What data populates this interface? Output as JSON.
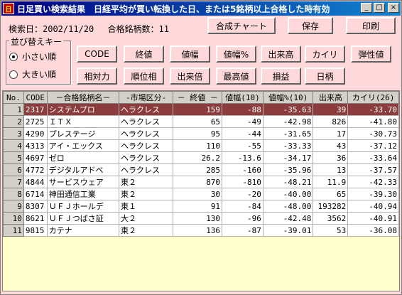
{
  "window": {
    "title": "日足買い検索結果　日経平均が買い転換した日、または5銘柄以上合格した時有効",
    "icon_text": "日",
    "controls": [
      "_",
      "□",
      "×"
    ]
  },
  "info": {
    "search_date": "検索日：2002/11/20",
    "count": "合格銘柄数：11"
  },
  "toolbar": {
    "composite_chart": "合成チャート",
    "save": "保存",
    "print": "印刷"
  },
  "sort": {
    "title": "並び替えキー",
    "ascending": "小さい順",
    "descending": "大きい順",
    "selected": "ascending"
  },
  "sort_buttons": [
    "CODE",
    "終値",
    "値幅",
    "値幅%",
    "出来高",
    "カイリ",
    "弾性値",
    "相対力",
    "順位相",
    "出来倍",
    "最高値",
    "損益",
    "日柄"
  ],
  "table": {
    "columns": [
      "No.",
      "CODE",
      "－合格銘柄名－",
      "-市場区分-",
      "－ 終値 －",
      "値幅(10)",
      "値幅%(10)",
      "出来高",
      "カイリ(26)"
    ],
    "selected_row": 0,
    "rows": [
      [
        "1",
        "2317",
        "システムプロ",
        "ヘラクレス",
        "159",
        "-88",
        "-35.63",
        "39",
        "-33.70"
      ],
      [
        "2",
        "2725",
        "ＩＴＸ",
        "ヘラクレス",
        "65",
        "-49",
        "-42.98",
        "826",
        "-41.80"
      ],
      [
        "3",
        "4290",
        "プレステージ",
        "ヘラクレス",
        "95",
        "-44",
        "-31.65",
        "17",
        "-30.73"
      ],
      [
        "4",
        "4313",
        "アイ・エックス",
        "ヘラクレス",
        "110",
        "-55",
        "-33.33",
        "43",
        "-37.12"
      ],
      [
        "5",
        "4697",
        "ゼロ",
        "ヘラクレス",
        "26.2",
        "-13.6",
        "-34.17",
        "36",
        "-33.64"
      ],
      [
        "6",
        "4772",
        "デジタルアドベ",
        "ヘラクレス",
        "285",
        "-160",
        "-35.96",
        "13",
        "-37.57"
      ],
      [
        "7",
        "4844",
        "サービスウェア",
        "東２",
        "870",
        "-810",
        "-48.21",
        "11.9",
        "-42.33"
      ],
      [
        "8",
        "6714",
        "神田通信工業",
        "東２",
        "30",
        "-20",
        "-40.00",
        "65",
        "-39.30"
      ],
      [
        "9",
        "8307",
        "ＵＦＪホールデ",
        "東１",
        "91",
        "-84",
        "-48.00",
        "193282",
        "-40.94"
      ],
      [
        "10",
        "8621",
        "ＵＦＪつばさ証",
        "大２",
        "130",
        "-96",
        "-42.48",
        "3562",
        "-40.91"
      ],
      [
        "11",
        "9815",
        "カテナ",
        "東２",
        "136",
        "-87",
        "-39.01",
        "53",
        "-36.08"
      ]
    ]
  }
}
